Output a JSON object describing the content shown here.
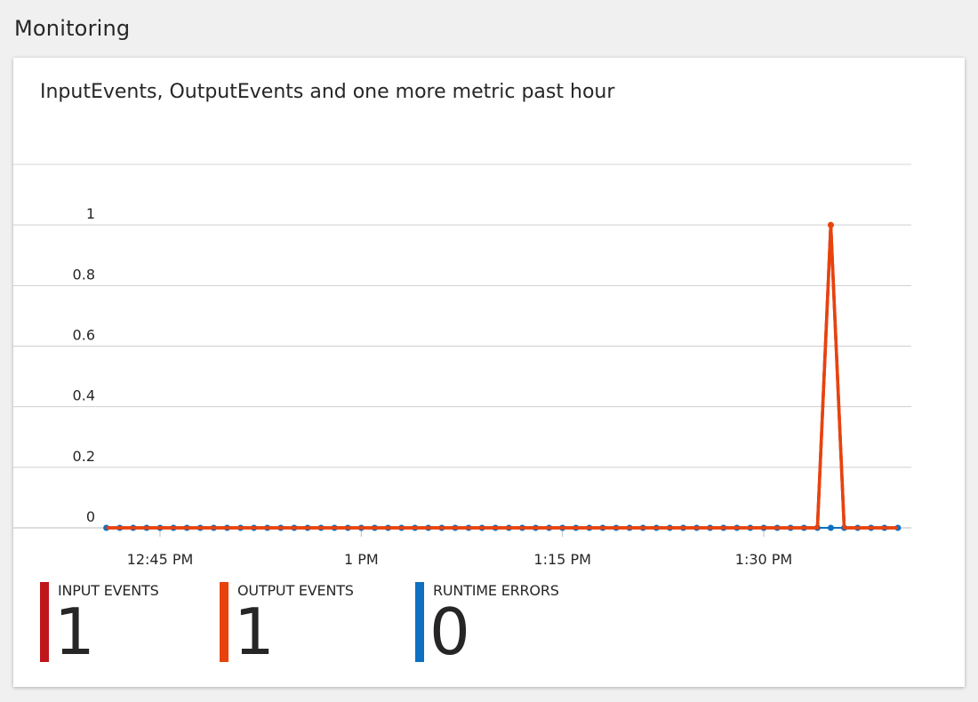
{
  "section": {
    "title": "Monitoring"
  },
  "chart_data": {
    "type": "line",
    "title": "InputEvents, OutputEvents and one more metric past hour",
    "x_tick_labels": [
      "12:45 PM",
      "1 PM",
      "1:15 PM",
      "1:30 PM"
    ],
    "x_tick_minutes": [
      45,
      60,
      75,
      90
    ],
    "x_start_minute": 41,
    "x_end_minute": 100,
    "point_interval_minutes": 1,
    "y_tick_labels": [
      "0",
      "0.2",
      "0.4",
      "0.6",
      "0.8",
      "1"
    ],
    "ylim": [
      0,
      1.2
    ],
    "grid": true,
    "series": [
      {
        "name": "INPUT EVENTS",
        "color": "#c0151b",
        "spike_minute": 95,
        "spike_value": 1,
        "show_markers": false
      },
      {
        "name": "OUTPUT EVENTS",
        "color": "#e8430d",
        "spike_minute": 95,
        "spike_value": 1,
        "show_markers": true
      },
      {
        "name": "RUNTIME ERRORS",
        "color": "#0d70c2",
        "spike_minute": null,
        "spike_value": 0,
        "show_markers": true
      }
    ]
  },
  "tiles": [
    {
      "label": "INPUT EVENTS",
      "value": "1",
      "color": "#c0151b"
    },
    {
      "label": "OUTPUT EVENTS",
      "value": "1",
      "color": "#e8430d"
    },
    {
      "label": "RUNTIME ERRORS",
      "value": "0",
      "color": "#0d70c2"
    }
  ]
}
